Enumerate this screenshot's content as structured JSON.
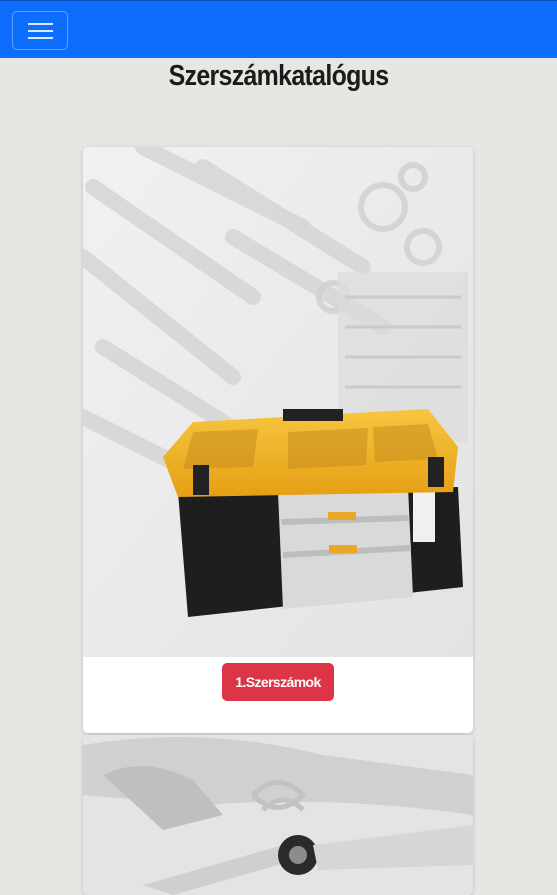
{
  "navbar": {
    "brand_color": "#0d6efd",
    "toggler_icon": "hamburger-icon"
  },
  "page": {
    "title": "Szerszámkatalógus"
  },
  "cards": [
    {
      "image": "toolbox-image",
      "button_label": "1.Szerszámok",
      "button_color": "#dc3545"
    },
    {
      "image": "wrench-tools-image"
    }
  ]
}
